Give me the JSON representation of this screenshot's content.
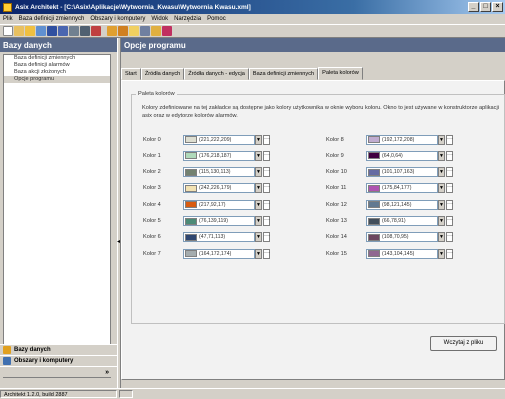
{
  "window": {
    "title": "Asix Architekt - [C:\\Asix\\Aplikacje\\Wytwornia_Kwasu\\Wytwornia Kwasu.xml]"
  },
  "menu": [
    "Plik",
    "Baza definicji zmiennych",
    "Obszary i komputery",
    "Widok",
    "Narzędzia",
    "Pomoc"
  ],
  "left": {
    "header": "Bazy danych",
    "items": [
      "Baza definicji zmiennych",
      "Baza definicji alarmów",
      "Baza akcji złożonych",
      "Opcje programu"
    ],
    "nav": [
      "Bazy danych",
      "Obszary i komputery"
    ]
  },
  "right": {
    "header": "Opcje programu",
    "tabs": [
      "Start",
      "Źródła danych",
      "Źródła danych - edycja",
      "Baza definicji zmiennych",
      "Paleta kolorów"
    ],
    "group_title": "Paleta kolorów",
    "description": "Kolory zdefiniowane na tej zakładce są dostępne jako kolory użytkownika w oknie wyboru koloru. Okno to jest używane w konstruktorze aplikacji asix oraz w  edytorze kolorów alarmów.",
    "colors": [
      {
        "label": "Kolor 0",
        "value": "(221,222,209)",
        "hex": "#ddded1"
      },
      {
        "label": "Kolor 1",
        "value": "(176,218,187)",
        "hex": "#b0dabb"
      },
      {
        "label": "Kolor 2",
        "value": "(115,130,113)",
        "hex": "#738271"
      },
      {
        "label": "Kolor 3",
        "value": "(242,226,179)",
        "hex": "#f2e2b3"
      },
      {
        "label": "Kolor 4",
        "value": "(217,92,17)",
        "hex": "#d95c11"
      },
      {
        "label": "Kolor 5",
        "value": "(76,139,119)",
        "hex": "#4c8b77"
      },
      {
        "label": "Kolor 6",
        "value": "(47,71,113)",
        "hex": "#2f4771"
      },
      {
        "label": "Kolor 7",
        "value": "(164,172,174)",
        "hex": "#a4acae"
      },
      {
        "label": "Kolor 8",
        "value": "(192,172,208)",
        "hex": "#c0acd0"
      },
      {
        "label": "Kolor 9",
        "value": "(64,0,64)",
        "hex": "#400040"
      },
      {
        "label": "Kolor 10",
        "value": "(101,107,163)",
        "hex": "#656ba3"
      },
      {
        "label": "Kolor 11",
        "value": "(175,84,177)",
        "hex": "#af54b1"
      },
      {
        "label": "Kolor 12",
        "value": "(98,121,145)",
        "hex": "#627991"
      },
      {
        "label": "Kolor 13",
        "value": "(66,78,91)",
        "hex": "#424e5b"
      },
      {
        "label": "Kolor 14",
        "value": "(108,70,95)",
        "hex": "#6c465f"
      },
      {
        "label": "Kolor 15",
        "value": "(143,104,145)",
        "hex": "#8f6891"
      }
    ],
    "load_button": "Wczytaj z pliku"
  },
  "status": "Architekt 1.2.0, build 2887"
}
